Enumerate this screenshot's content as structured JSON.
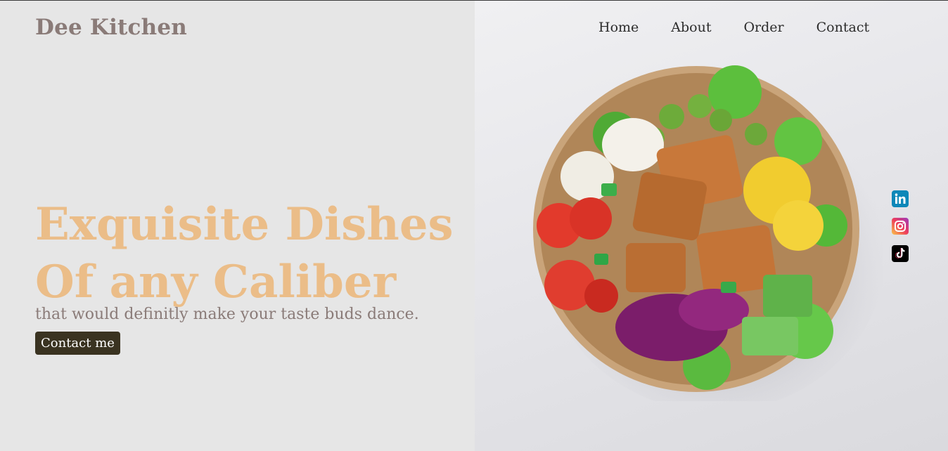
{
  "brand": {
    "name": "Dee Kitchen"
  },
  "nav": {
    "items": [
      {
        "label": "Home"
      },
      {
        "label": "About"
      },
      {
        "label": "Order"
      },
      {
        "label": "Contact"
      }
    ]
  },
  "hero": {
    "title_line1": "Exquisite Dishes",
    "title_line2": "Of any Caliber",
    "tagline": "that would definitly make your taste buds dance.",
    "cta_label": "Contact me"
  },
  "social": {
    "icons": [
      "linkedin-icon",
      "instagram-icon",
      "tiktok-icon"
    ]
  },
  "image": {
    "subject": "salad-bowl-image"
  },
  "colors": {
    "brand": "#8a7b78",
    "title": "#ebbd88",
    "cta_bg": "#3a3321",
    "background": "#e6e6e6"
  }
}
